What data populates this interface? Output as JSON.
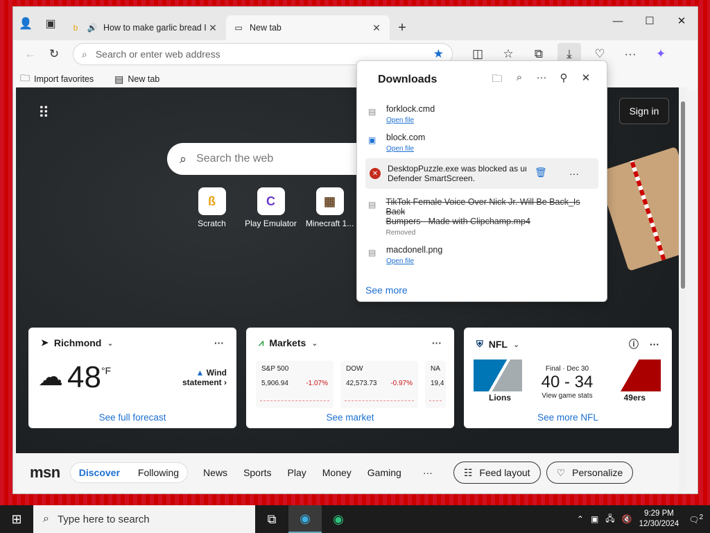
{
  "tabs": [
    {
      "title": "How to make garlic bread I w",
      "active": false
    },
    {
      "title": "New tab",
      "active": true
    }
  ],
  "address": {
    "placeholder": "Search or enter web address"
  },
  "favorites": [
    {
      "label": "Import favorites"
    },
    {
      "label": "New tab"
    }
  ],
  "page": {
    "sign_in": "Sign in",
    "search_placeholder": "Search the web",
    "quicklinks": [
      {
        "label": "Scratch"
      },
      {
        "label": "Play Emulator"
      },
      {
        "label": "Minecraft 1..."
      }
    ]
  },
  "weather": {
    "location": "Richmond",
    "temp": "48",
    "unit": "°F",
    "alert_line1": "Wind",
    "alert_line2": "statement",
    "link": "See full forecast"
  },
  "markets": {
    "title": "Markets",
    "items": [
      {
        "name": "S&P 500",
        "value": "5,906.94",
        "change": "-1.07%"
      },
      {
        "name": "DOW",
        "value": "42,573.73",
        "change": "-0.97%"
      },
      {
        "name": "NA",
        "value": "19,4",
        "change": ""
      }
    ],
    "link": "See market"
  },
  "nfl": {
    "title": "NFL",
    "status": "Final · Dec 30",
    "score": "40 - 34",
    "view": "View game stats",
    "team1": "Lions",
    "team2": "49ers",
    "link": "See more NFL"
  },
  "msn": {
    "logo": "msn",
    "tabs": [
      "Discover",
      "Following"
    ],
    "nav": [
      "News",
      "Sports",
      "Play",
      "Money",
      "Gaming"
    ],
    "more": "···",
    "feed_layout": "Feed layout",
    "personalize": "Personalize"
  },
  "downloads": {
    "title": "Downloads",
    "items": [
      {
        "name": "forklock.cmd",
        "action": "Open file"
      },
      {
        "name": "block.com",
        "action": "Open file"
      }
    ],
    "blocked_line1": "DesktopPuzzle.exe was blocked as un",
    "blocked_line2": "Defender SmartScreen.",
    "removed_line1": "TikTok Female Voice Over Nick Jr. Will Be Back_Is Back",
    "removed_line2": "Bumpers - Made with Clipchamp.mp4",
    "removed_status": "Removed",
    "last_item": {
      "name": "macdonell.png",
      "action": "Open file"
    },
    "see_more": "See more"
  },
  "taskbar": {
    "search_placeholder": "Type here to search",
    "time": "9:29 PM",
    "date": "12/30/2024",
    "notif_count": "2"
  }
}
